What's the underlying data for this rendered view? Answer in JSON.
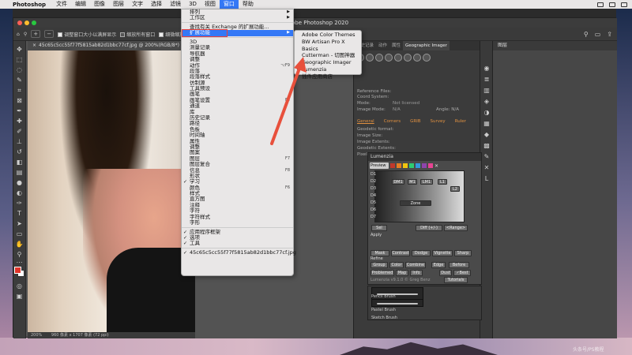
{
  "menubar": {
    "app_name": "Photoshop",
    "items": [
      "文件",
      "编辑",
      "图像",
      "图层",
      "文字",
      "选择",
      "滤镜",
      "3D",
      "视图",
      "窗口",
      "帮助"
    ],
    "active_item": "窗口"
  },
  "window": {
    "title_suffix": "obe Photoshop 2020"
  },
  "options_bar": {
    "checkbox1": "调整窗口大小以满屏显示",
    "checkbox2": "缩放所有窗口",
    "checkbox3": "细微缩放"
  },
  "document": {
    "tab": "45c65c5cc55f77f5815ab82d1bbc77cf.jpg @ 200%(RGB/8*)",
    "zoom": "200%",
    "info": "960 像素 x 1707 像素 (72 ppi)"
  },
  "window_menu": {
    "items": [
      {
        "label": "排列",
        "arrow": true
      },
      {
        "label": "工作区",
        "arrow": true
      },
      {
        "sep": true
      },
      {
        "label": "查找有关 Exchange 的扩展功能..."
      },
      {
        "label": "扩展功能",
        "arrow": true,
        "highlight": true
      },
      {
        "sep": true
      },
      {
        "label": "3D"
      },
      {
        "label": "测量记录"
      },
      {
        "label": "导航器"
      },
      {
        "label": "调整"
      },
      {
        "label": "动作",
        "shortcut": "⌥F9"
      },
      {
        "label": "段落"
      },
      {
        "label": "段落样式"
      },
      {
        "label": "仿制源"
      },
      {
        "label": "工具预设"
      },
      {
        "label": "画笔"
      },
      {
        "label": "画笔设置",
        "shortcut": "F5"
      },
      {
        "label": "通道"
      },
      {
        "label": "库"
      },
      {
        "label": "历史记录"
      },
      {
        "label": "路径"
      },
      {
        "label": "色板"
      },
      {
        "label": "时间轴"
      },
      {
        "label": "属性"
      },
      {
        "label": "调整"
      },
      {
        "label": "图案"
      },
      {
        "label": "图层",
        "shortcut": "F7"
      },
      {
        "label": "图层复合"
      },
      {
        "label": "信息",
        "shortcut": "F8"
      },
      {
        "label": "形状"
      },
      {
        "label": "学习",
        "check": true
      },
      {
        "label": "颜色",
        "shortcut": "F6"
      },
      {
        "label": "样式"
      },
      {
        "label": "直方图"
      },
      {
        "label": "注释"
      },
      {
        "label": "字符"
      },
      {
        "label": "字符样式"
      },
      {
        "label": "字形"
      },
      {
        "sep": true
      },
      {
        "label": "应用程序框架",
        "check": true
      },
      {
        "label": "选项",
        "check": true
      },
      {
        "label": "工具",
        "check": true
      },
      {
        "sep": true
      },
      {
        "label": "45c65c5cc55f77f5815ab82d1bbc77cf.jpg",
        "check": true
      }
    ]
  },
  "extensions_submenu": {
    "items": [
      {
        "label": "Adobe Color Themes"
      },
      {
        "label": "BW Artisan Pro X"
      },
      {
        "label": "Basics"
      },
      {
        "label": "Cutterman - 切图神器"
      },
      {
        "label": "Geographic Imager"
      },
      {
        "label": "Lumenzia",
        "check": true
      },
      {
        "label": "插件应用商店"
      }
    ]
  },
  "geo_panel": {
    "tabs": [
      "历史记录",
      "动作",
      "属性",
      "Geographic Imager"
    ],
    "active_tab": "Geographic Imager",
    "lines": [
      {
        "label": "Reference Files:",
        "value": ""
      },
      {
        "label": "Coord System:",
        "value": ""
      },
      {
        "label": "Mode:",
        "value": "Not licensed"
      },
      {
        "label": "Image Mode:",
        "value": "N/A"
      }
    ],
    "angle_label": "Angle: N/A",
    "subtabs": [
      "General",
      "Corners",
      "GRIB",
      "Survey",
      "Ruler"
    ],
    "info_lines": [
      "Geodetic format:",
      "Image Size:",
      "Image Extents:",
      "Geodetic Extents:",
      "Pixel Size:"
    ]
  },
  "lumenzia": {
    "title": "Lumenzia",
    "preview": "Preview",
    "swatch_colors": [
      "#c0392b",
      "#e67e22",
      "#f1c40f",
      "#2ecc71",
      "#3498db",
      "#8e44ad",
      "#e84393"
    ],
    "row_labels": [
      "D1",
      "D2",
      "D3",
      "D4",
      "D5",
      "D6",
      "D7"
    ],
    "mid_buttons": [
      "DM1",
      "M1",
      "LM1",
      "L1",
      "L2"
    ],
    "zone_label": "Zone",
    "range_label": "<Range>",
    "diff_label": "Diff (+/-)",
    "apply_label": "Apply",
    "sel_label": "Sel",
    "mask_buttons": [
      "Mask",
      "Contrast",
      "Dodge",
      "Vignette",
      "Sharp"
    ],
    "refine_label": "Refine",
    "refine_buttons": [
      "Group",
      "Color",
      "Combine",
      "Edge",
      "Before"
    ],
    "bottom_buttons": [
      "Problemed",
      "Map",
      "Info",
      "Dust",
      "✓Best"
    ],
    "version": "Lumenzia v9.1.0 © Greg Benz",
    "tutorials": "Tutorials"
  },
  "brushes": {
    "labels": [
      "Pencil Brush",
      "Pastel Brush",
      "Sketch Brush"
    ]
  },
  "far_panel": {
    "tab": "图层"
  },
  "watermark": "头条号/PS教程"
}
